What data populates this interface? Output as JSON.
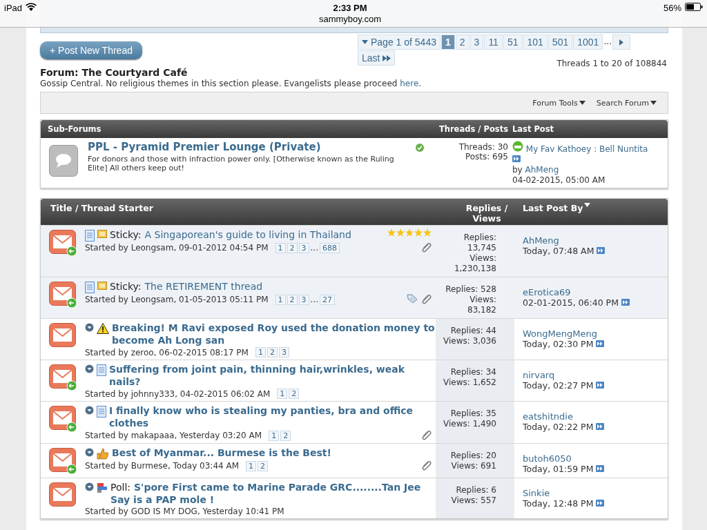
{
  "status_bar": {
    "device": "iPad",
    "time": "2:33 PM",
    "url": "sammyboy.com",
    "battery": "56%"
  },
  "post_button": "+ Post New Thread",
  "pagination": {
    "summary": "Page 1 of 5443",
    "pages": [
      {
        "label": "1",
        "selected": true
      },
      {
        "label": "2",
        "selected": false
      },
      {
        "label": "3",
        "selected": false
      },
      {
        "label": "11",
        "selected": false
      },
      {
        "label": "51",
        "selected": false
      },
      {
        "label": "101",
        "selected": false
      },
      {
        "label": "501",
        "selected": false
      },
      {
        "label": "1001",
        "selected": false
      }
    ],
    "ellipsis": "...",
    "last": "Last"
  },
  "forum": {
    "title": "Forum: The Courtyard Café",
    "description": "Gossip Central. No religious themes in this section please. Evangelists please proceed",
    "link": "here",
    "period": ".",
    "count": "Threads 1 to 20 of 108844"
  },
  "tools": [
    "Forum Tools",
    "Search Forum"
  ],
  "subforums": {
    "columns": [
      "Sub-Forums",
      "Threads / Posts",
      "Last Post"
    ],
    "items": [
      {
        "name": "PPL - Pyramid Premier Lounge (Private)",
        "description": "For donors and those with infraction power only. [Otherwise known as the Ruling Elite] All others keep out!",
        "threads": "Threads: 30",
        "posts": "Posts: 695",
        "last_title": "My Fav Kathoey : Bell Nuntita",
        "by": "by",
        "last_user": "AhMeng",
        "last_date": "04-02-2015, 05:00 AM"
      }
    ]
  },
  "threads": {
    "columns": [
      "Title / Thread Starter",
      "Replies / Views",
      "Last Post By"
    ],
    "rows": [
      {
        "sticky": true,
        "bold": false,
        "own": true,
        "icons": [
          {
            "kind": "page"
          },
          {
            "kind": "note"
          }
        ],
        "prefix": "Sticky:",
        "title": "A Singaporean's guide to living in Thailand",
        "stars": 5,
        "starter": "Started by Leongsam, 09-01-2012 04:54 PM",
        "pages": [
          "1",
          "2",
          "3"
        ],
        "ellipsis": "...",
        "last_page": "688",
        "tagged": false,
        "attachment": true,
        "replies": "Replies: 13,745",
        "views": "Views: 1,230,138",
        "last_user": "AhMeng",
        "last_time": "Today, 07:48 AM"
      },
      {
        "sticky": true,
        "bold": false,
        "own": true,
        "icons": [
          {
            "kind": "page"
          },
          {
            "kind": "note"
          }
        ],
        "prefix": "Sticky:",
        "title": "The RETIREMENT thread",
        "starter": "Started by Leongsam, 01-05-2013 05:11 PM",
        "pages": [
          "1",
          "2",
          "3"
        ],
        "ellipsis": "...",
        "last_page": "27",
        "tagged": true,
        "attachment": true,
        "replies": "Replies: 528",
        "views": "Views: 83,182",
        "last_user": "eErotica69",
        "last_time": "02-01-2015, 06:40 PM"
      },
      {
        "sticky": false,
        "bold": true,
        "own": false,
        "icons": [
          {
            "kind": "unread"
          },
          {
            "kind": "warning"
          }
        ],
        "title": "Breaking! M Ravi exposed Roy used the donation money to become Ah Long san",
        "starter": "Started by zeroo, 06-02-2015 08:17 PM",
        "pages": [
          "1",
          "2",
          "3"
        ],
        "tagged": false,
        "attachment": false,
        "replies": "Replies: 44",
        "views": "Views: 3,036",
        "last_user": "WongMengMeng",
        "last_time": "Today, 02:30 PM"
      },
      {
        "sticky": false,
        "bold": true,
        "own": true,
        "icons": [
          {
            "kind": "unread"
          },
          {
            "kind": "page"
          }
        ],
        "title": "Suffering from joint pain, thinning hair,wrinkles, weak nails?",
        "starter": "Started by johnny333, 04-02-2015 06:02 AM",
        "pages": [
          "1",
          "2"
        ],
        "tagged": false,
        "attachment": false,
        "replies": "Replies: 34",
        "views": "Views: 1,652",
        "last_user": "nirvarq",
        "last_time": "Today, 02:27 PM"
      },
      {
        "sticky": false,
        "bold": true,
        "own": true,
        "icons": [
          {
            "kind": "unread"
          },
          {
            "kind": "page"
          }
        ],
        "title": "I finally know who is stealing my panties, bra and office clothes",
        "starter": "Started by makapaaa, Yesterday 03:20 AM",
        "pages": [
          "1",
          "2"
        ],
        "tagged": false,
        "attachment": true,
        "replies": "Replies: 35",
        "views": "Views: 1,490",
        "last_user": "eatshitndie",
        "last_time": "Today, 02:22 PM"
      },
      {
        "sticky": false,
        "bold": true,
        "own": true,
        "icons": [
          {
            "kind": "unread"
          },
          {
            "kind": "thumb"
          }
        ],
        "title": "Best of Myanmar... Burmese is the Best!",
        "starter": "Started by Burmese, Today 03:44 AM",
        "pages": [
          "1",
          "2"
        ],
        "tagged": false,
        "attachment": true,
        "replies": "Replies: 20",
        "views": "Views: 691",
        "last_user": "butoh6050",
        "last_time": "Today, 01:59 PM"
      },
      {
        "sticky": false,
        "bold": true,
        "own": false,
        "icons": [
          {
            "kind": "unread"
          },
          {
            "kind": "poll"
          }
        ],
        "prefix": "Poll:",
        "title": "S'pore First came to Marine Parade GRC........Tan Jee Say is a PAP mole !",
        "starter": "Started by GOD IS MY DOG, Yesterday 10:41 PM",
        "pages": [],
        "tagged": false,
        "attachment": false,
        "replies": "Replies: 6",
        "views": "Views: 557",
        "last_user": "Sinkie",
        "last_time": "Today, 12:48 PM"
      }
    ]
  }
}
